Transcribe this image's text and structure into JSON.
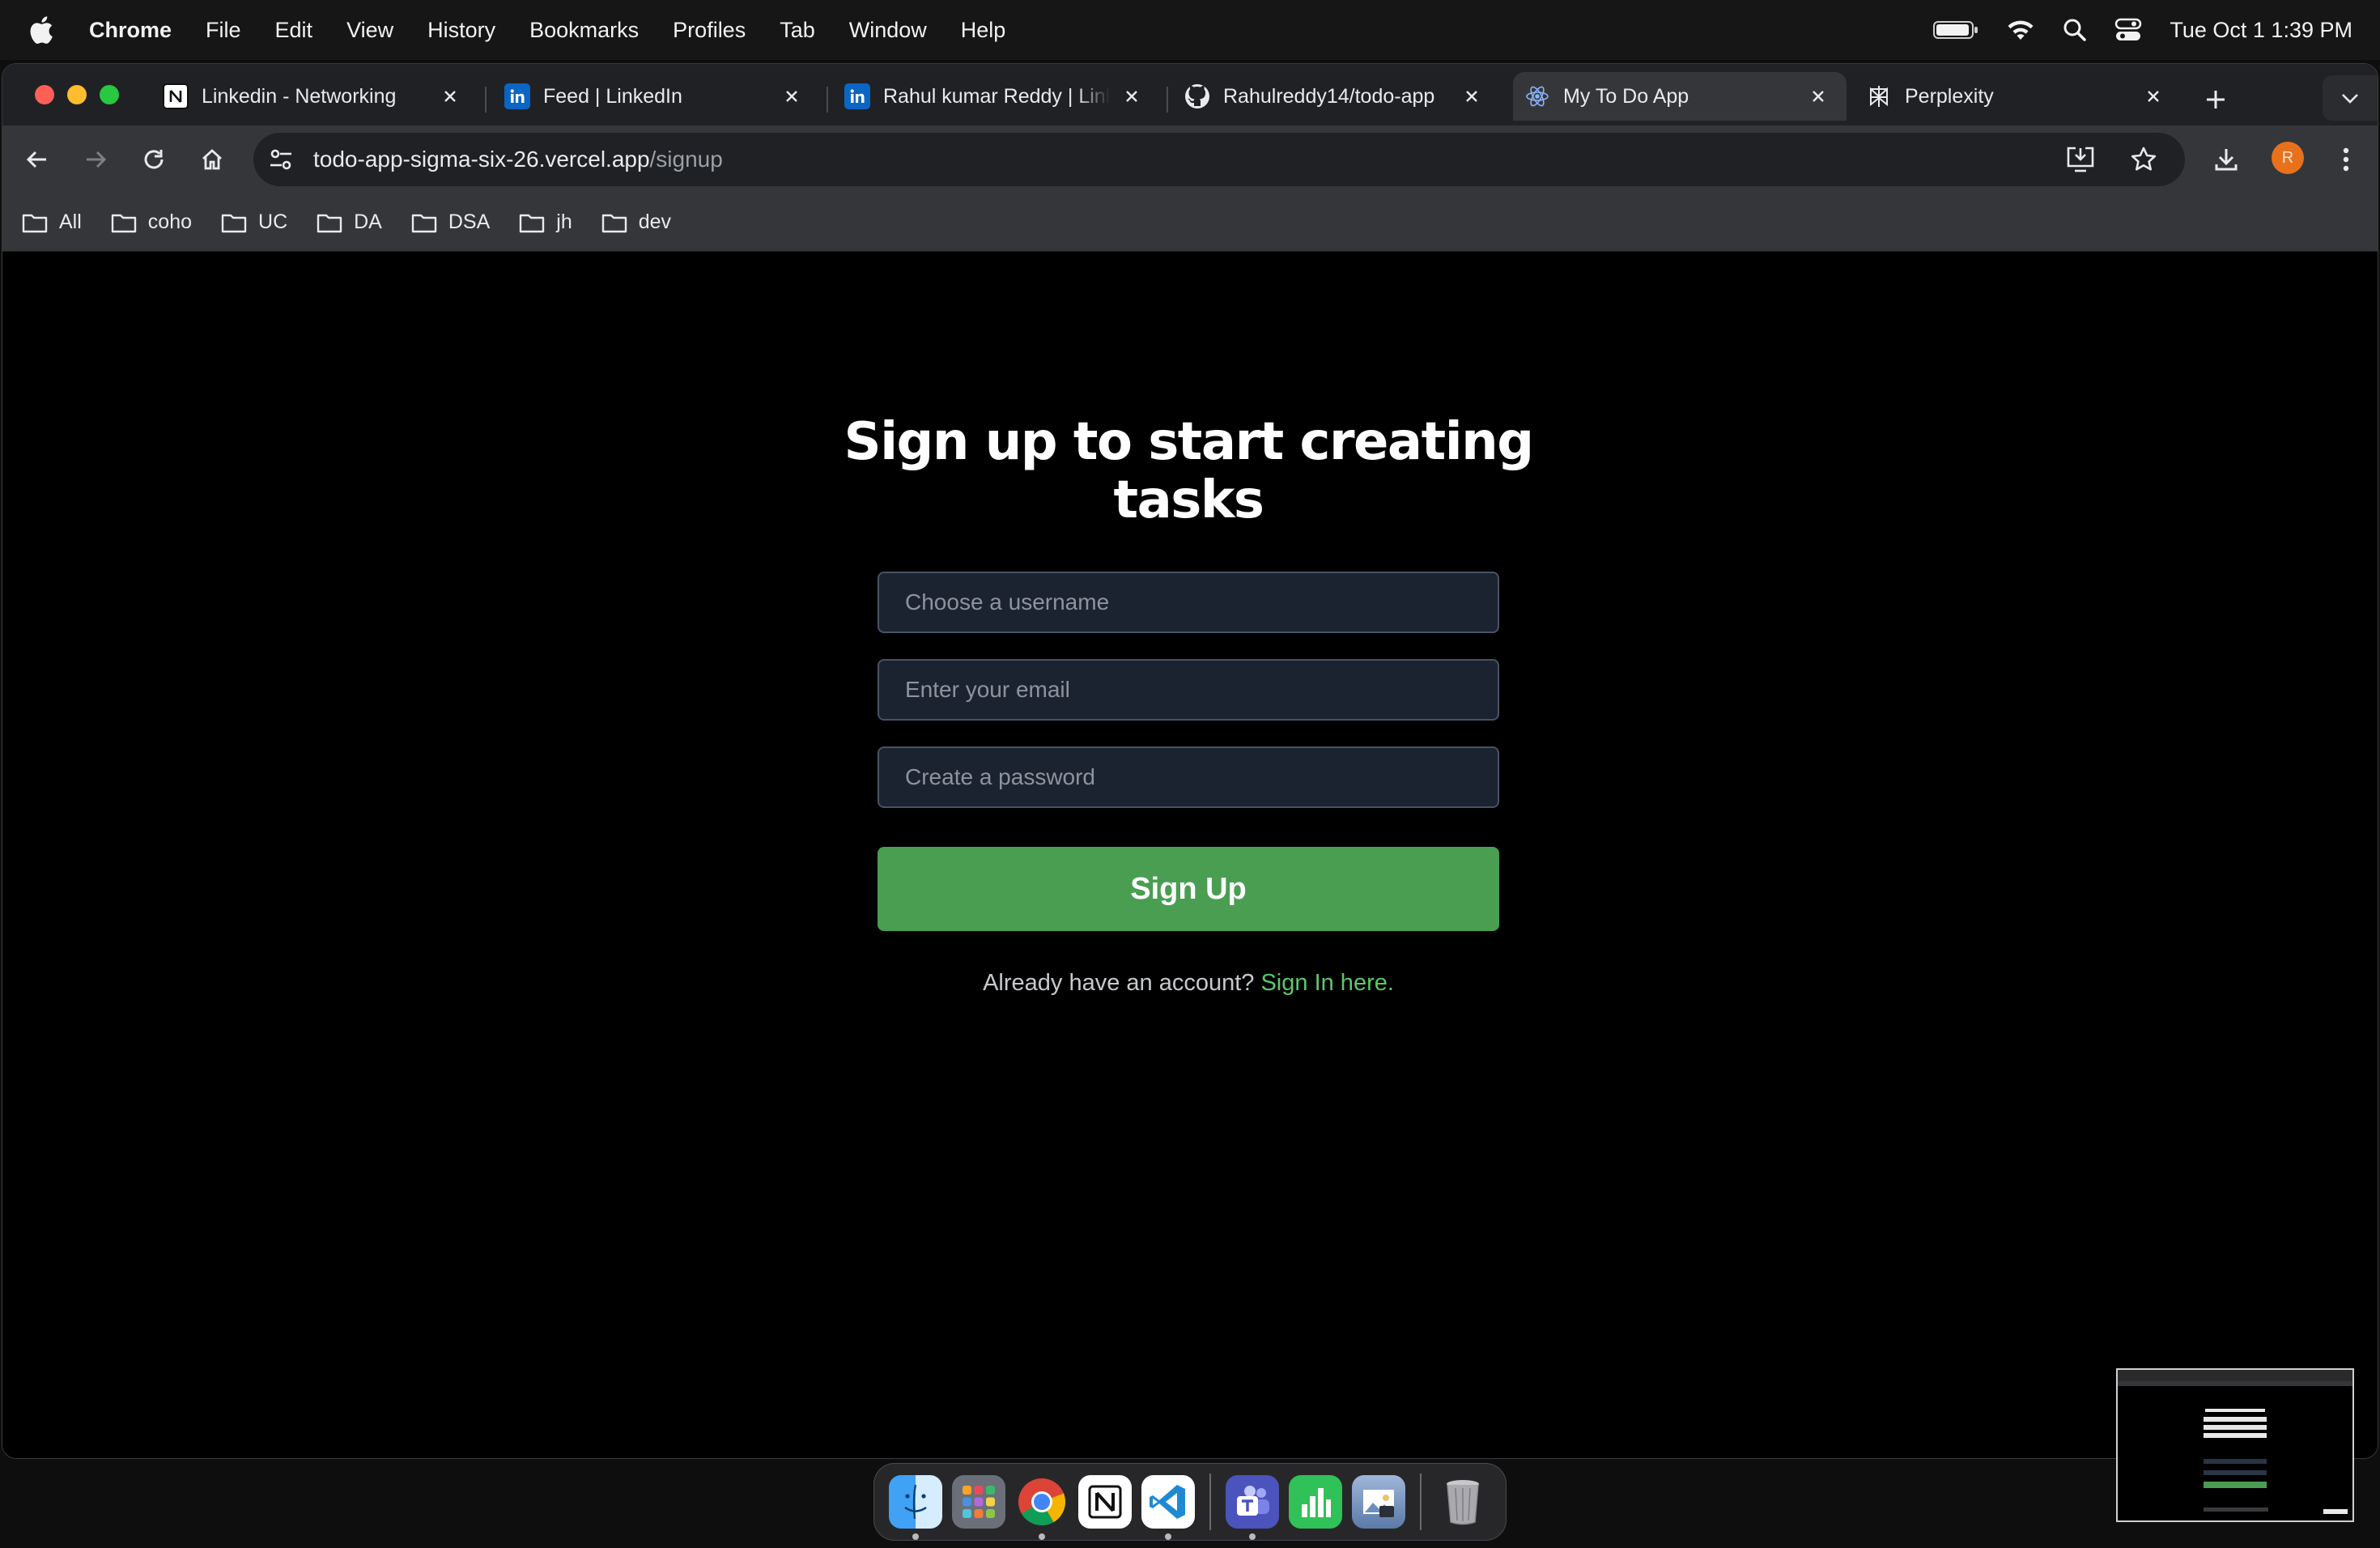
{
  "menubar": {
    "app_name": "Chrome",
    "items": [
      "File",
      "Edit",
      "View",
      "History",
      "Bookmarks",
      "Profiles",
      "Tab",
      "Window",
      "Help"
    ],
    "clock": "Tue Oct 1  1:39 PM"
  },
  "tabs": [
    {
      "title": "Linkedin - Networking",
      "icon": "notion-icon"
    },
    {
      "title": "Feed | LinkedIn",
      "icon": "linkedin-icon"
    },
    {
      "title": "Rahul kumar Reddy | LinkedIn",
      "icon": "linkedin-icon"
    },
    {
      "title": "Rahulreddy14/todo-app",
      "icon": "github-icon"
    },
    {
      "title": "My To Do App",
      "icon": "react-icon",
      "active": true
    },
    {
      "title": "Perplexity",
      "icon": "perplexity-icon"
    }
  ],
  "address_bar": {
    "host": "todo-app-sigma-six-26.vercel.app",
    "path": "/signup"
  },
  "profile_initial": "R",
  "bookmarks": [
    "All",
    "coho",
    "UC",
    "DA",
    "DSA",
    "jh",
    "dev"
  ],
  "signup": {
    "heading_line1": "Sign up to start creating",
    "heading_line2": "tasks",
    "username_placeholder": "Choose a username",
    "email_placeholder": "Enter your email",
    "password_placeholder": "Create a password",
    "submit_label": "Sign Up",
    "account_prompt": "Already have an account?",
    "signin_link": "Sign In here."
  },
  "colors": {
    "accent_green": "#4a9e52",
    "link_green": "#5cc76a",
    "input_bg": "#1b2331"
  },
  "dock": [
    "finder-icon",
    "launchpad-icon",
    "chrome-icon",
    "notion-icon",
    "vscode-icon",
    "teams-icon",
    "numbers-icon",
    "preview-icon",
    "trash-icon"
  ]
}
